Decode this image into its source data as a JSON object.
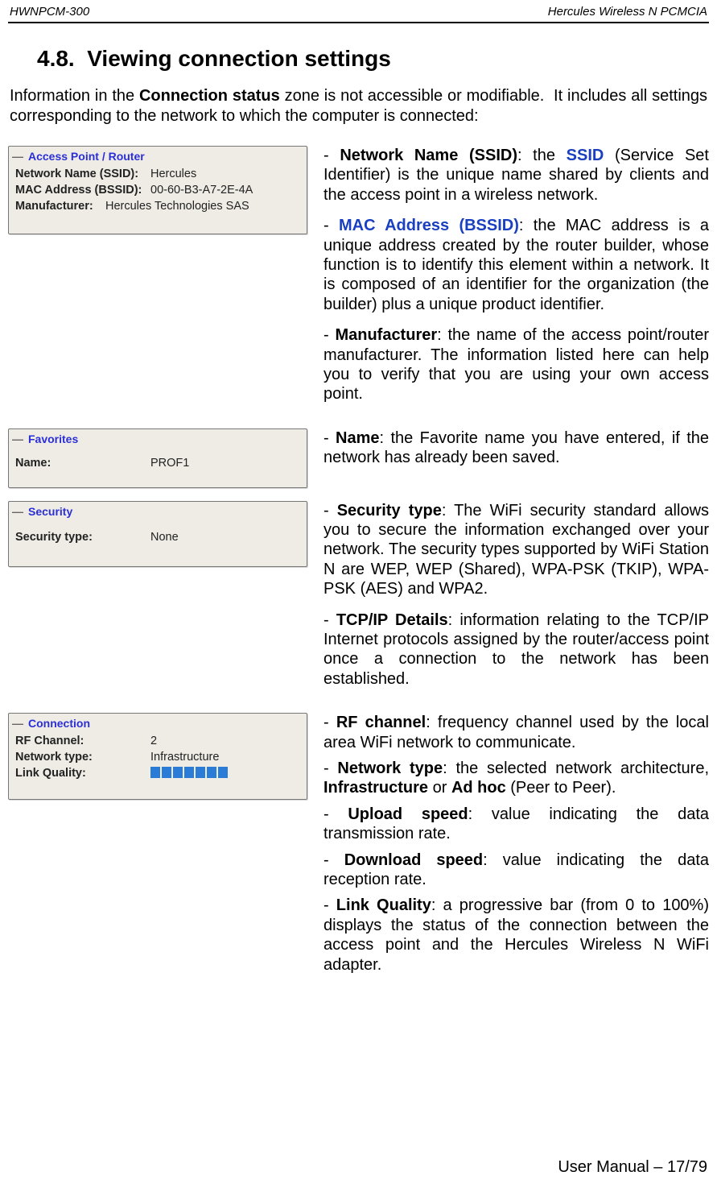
{
  "header": {
    "left": "HWNPCM-300",
    "right": "Hercules Wireless N PCMCIA"
  },
  "section": {
    "number": "4.8.",
    "title": "Viewing connection settings"
  },
  "intro": "Information in the Connection status zone is not accessible or modifiable.  It includes all settings corresponding to the network to which the computer is connected:",
  "intro_bold": "Connection status",
  "panels": {
    "accesspoint": {
      "legend": "Access Point / Router",
      "ssid_label": "Network Name (SSID):",
      "ssid_value": "Hercules",
      "bssid_label": "MAC Address (BSSID):",
      "bssid_value": "00-60-B3-A7-2E-4A",
      "manu_label": "Manufacturer:",
      "manu_value": "Hercules Technologies SAS"
    },
    "favorites": {
      "legend": "Favorites",
      "name_label": "Name:",
      "name_value": "PROF1"
    },
    "security": {
      "legend": "Security",
      "type_label": "Security type:",
      "type_value": "None"
    },
    "connection": {
      "legend": "Connection",
      "rf_label": "RF Channel:",
      "rf_value": "2",
      "nettype_label": "Network type:",
      "nettype_value": "Infrastructure",
      "link_label": "Link Quality:"
    }
  },
  "descriptions": {
    "ssid_term": "Network Name (SSID)",
    "ssid_link": "SSID",
    "ssid_text": " (Service Set Identifier) is the unique name shared by clients and the access point in a wireless network.",
    "bssid_term": "MAC Address (BSSID)",
    "bssid_text": ": the MAC address is a unique address created by the router builder, whose function is to identify this element within a network.  It is composed of an identifier for the organization (the builder) plus a unique product identifier.",
    "manu_term": "Manufacturer",
    "manu_text": ": the name of the access point/router manufacturer.  The information listed here can help you to verify that you are using your own access point.",
    "name_term": "Name",
    "name_text": ": the Favorite name you have entered, if the network has already been saved.",
    "sectype_term": "Security type",
    "sectype_text": ": The WiFi security standard allows you to secure the information exchanged over your network.  The security types supported by WiFi Station N are WEP, WEP (Shared), WPA-PSK (TKIP), WPA-PSK (AES) and WPA2.",
    "tcpip_term": "TCP/IP Details",
    "tcpip_text": ": information relating to the TCP/IP Internet protocols assigned by the router/access point once a connection to the network has been established.",
    "rf_term": "RF channel",
    "rf_text": ": frequency channel used by the local area WiFi network to communicate.",
    "nettype_term": "Network type",
    "nettype_text_a": ": the selected network architecture, ",
    "nettype_infra": "Infrastructure",
    "nettype_or": " or ",
    "nettype_adhoc": "Ad hoc",
    "nettype_text_b": " (Peer to Peer).",
    "upload_term": "Upload speed",
    "upload_text": ": value indicating the data transmission rate.",
    "download_term": "Download speed",
    "download_text": ": value indicating the data reception rate.",
    "link_term": "Link Quality",
    "link_text": ": a progressive bar (from 0 to 100%) displays the status of the connection between the access point and the Hercules Wireless N WiFi adapter."
  },
  "footer": "User Manual – 17/79"
}
